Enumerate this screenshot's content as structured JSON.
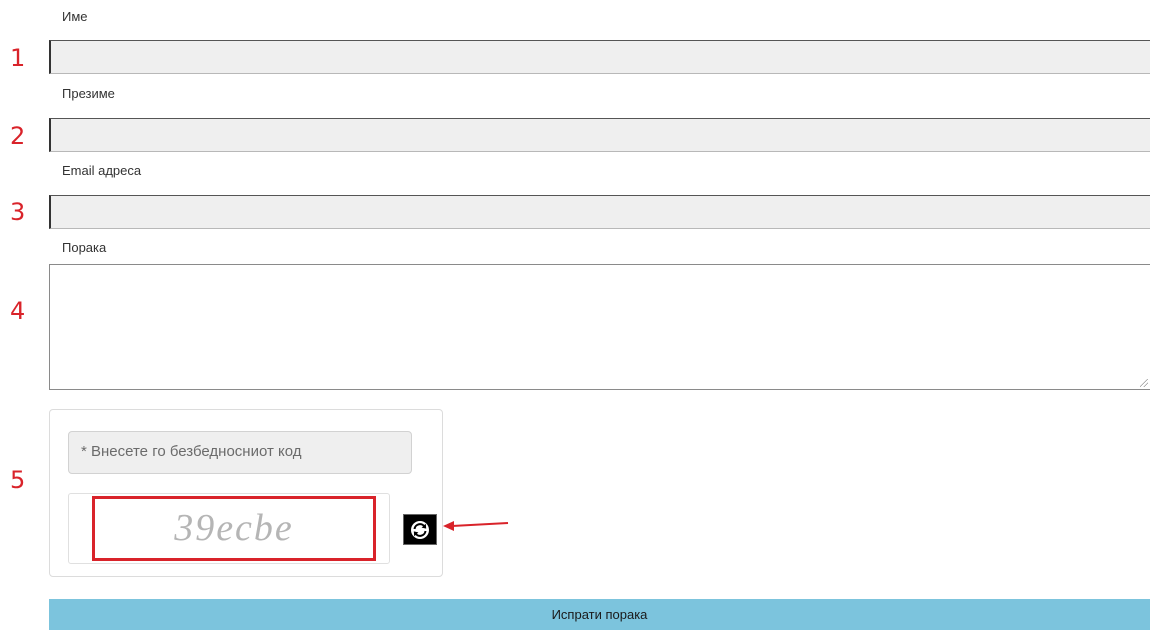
{
  "form": {
    "fields": [
      {
        "label": "Име",
        "annotation": "1",
        "value": ""
      },
      {
        "label": "Презиме",
        "annotation": "2",
        "value": ""
      },
      {
        "label": "Email адреса",
        "annotation": "3",
        "value": ""
      }
    ],
    "message": {
      "label": "Порака",
      "annotation": "4",
      "value": ""
    },
    "captcha": {
      "annotation": "5",
      "input_placeholder": "* Внесете го безбедносниот код",
      "code": "39ecbe",
      "refresh_icon": "refresh-icon"
    },
    "submit_label": "Испрати порака"
  },
  "colors": {
    "annotation_red": "#d9232a",
    "submit_bg": "#7cc4dd",
    "field_bg": "#efefef"
  }
}
